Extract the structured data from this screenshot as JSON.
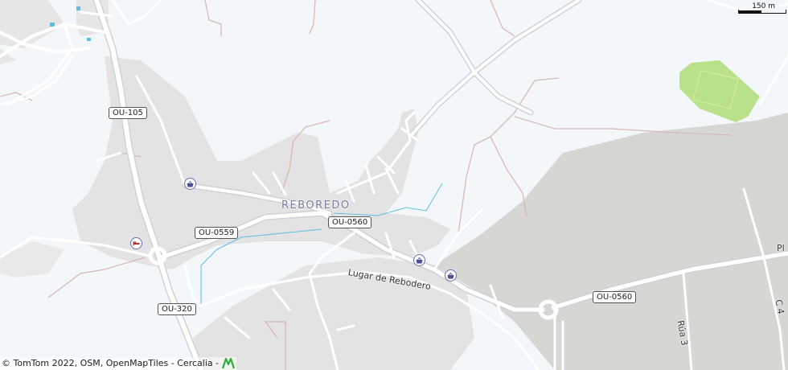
{
  "map": {
    "place_label": "REBOREDO",
    "road_shields": [
      "OU-105",
      "OU-0559",
      "OU-0560",
      "OU-320",
      "OU-0560"
    ],
    "street_labels": [
      "Lugar de Rebodero",
      "Rúa 3"
    ],
    "edge_labels": [
      "Pl",
      "C 4"
    ],
    "poi_icons": [
      "shopping-basket-icon",
      "shopping-basket-icon",
      "shopping-basket-icon",
      "lodging-bed-icon"
    ],
    "scale_label": "150 m",
    "attribution": "© TomTom 2022, OSM, OpenMapTiles - Cercalia -",
    "colors": {
      "background": "#f3f7fa",
      "landuse": "#e3e4e3",
      "industrial": "#d6d6d3",
      "road": "#ffffff",
      "road_casing": "#cfd3d6",
      "park": "#b9e08a",
      "water": "#5fbfe0",
      "path": "#d9b8b8"
    }
  }
}
